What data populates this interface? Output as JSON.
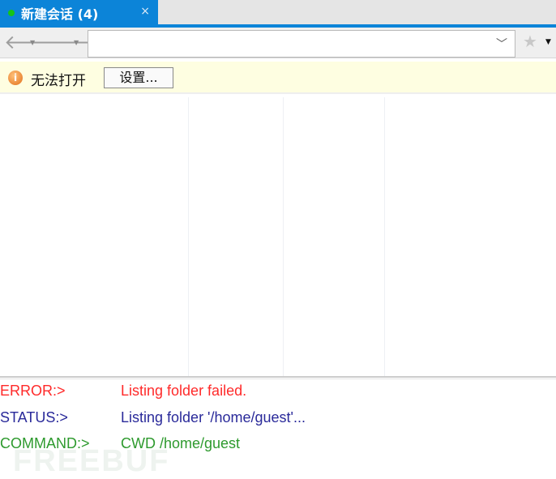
{
  "tab": {
    "title": "新建会话 (4)",
    "close": "×"
  },
  "toolbar": {
    "back": "🡐",
    "forward": "🡒",
    "dropdown": "▼",
    "address_value": "",
    "address_chevron": "﹀",
    "star": "★"
  },
  "infobar": {
    "icon": "i",
    "message": "无法打开",
    "settings_button": "设置..."
  },
  "log": [
    {
      "type": "ERROR:>",
      "message": "Listing folder failed.",
      "color": "#ff2a2a"
    },
    {
      "type": "STATUS:>",
      "message": "Listing folder '/home/guest'...",
      "color": "#2a2a9a"
    },
    {
      "type": "COMMAND:>",
      "message": "CWD /home/guest",
      "color": "#2e9a2e"
    }
  ],
  "watermark": "FREEBUF"
}
